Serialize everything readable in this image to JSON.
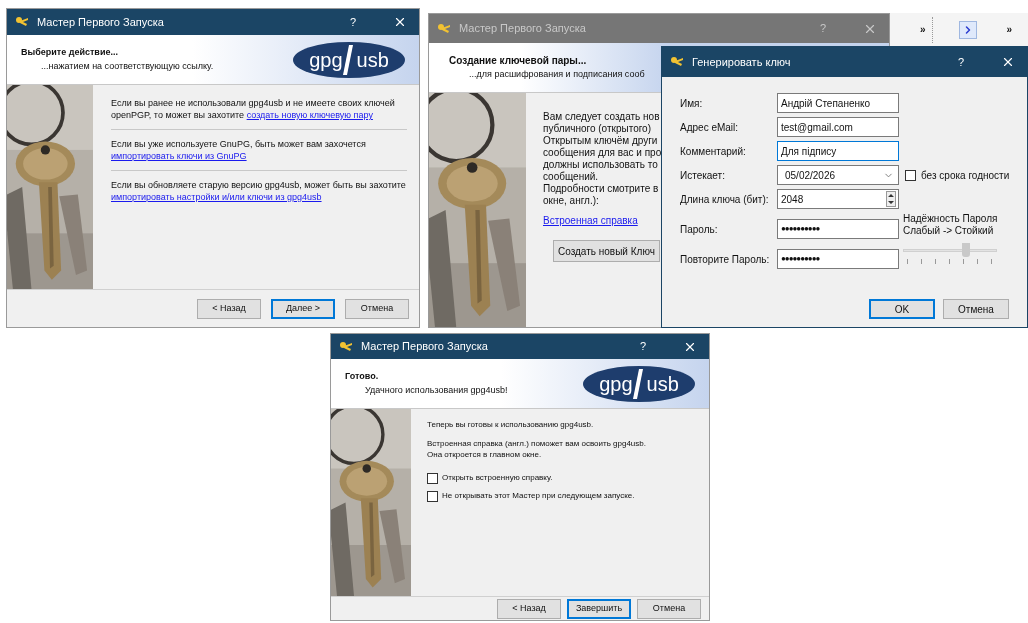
{
  "wizard_start": {
    "title": "Мастер Первого Запуска",
    "active": true,
    "help": "?",
    "header_title": "Выберите действие...",
    "header_subtitle": "...нажатием на соответствующую ссылку.",
    "logo": [
      "gpg",
      "usb"
    ],
    "paragraphs": [
      {
        "text": "Если вы ранее не использовали gpg4usb и не имеете своих ключей openPGP, то может вы захотите",
        "link": "создать новую ключевую пару"
      },
      {
        "text": "Если вы уже используете GnuPG, быть может вам захочется",
        "link": "импортировать ключи из GnuPG"
      },
      {
        "text": "Если вы обновляете старую версию gpg4usb, может быть вы захотите",
        "link": "импортировать настройки и/или ключи из gpg4usb"
      }
    ],
    "buttons": [
      {
        "label": "< Назад",
        "focused": false
      },
      {
        "label": "Далее >",
        "focused": true
      },
      {
        "label": "Отмена",
        "focused": false
      }
    ]
  },
  "wizard_keypair": {
    "title": "Мастер Первого Запуска",
    "active": false,
    "help": "?",
    "header_title": "Создание ключевой пары...",
    "header_subtitle": "...для расшифрования и подписания сооб",
    "lines": [
      "Вам следует создать нов",
      "публичного (открытого)",
      "Открытым ключём други",
      "сообщения для вас и про",
      "должны использовать то",
      "сообщений.",
      "Подробности смотрите в",
      "окне, англ.):"
    ],
    "link": "Встроенная справка",
    "button": "Создать новый Ключ"
  },
  "background_toolbar": {
    "overflow_marks": [
      "»",
      "»"
    ]
  },
  "keygen_dialog": {
    "title": "Генерировать ключ",
    "active": true,
    "help": "?",
    "fields": [
      {
        "label": "Имя:",
        "value": "Андрій Степаненко",
        "kind": "text",
        "focused": false
      },
      {
        "label": "Адрес eMail:",
        "value": "test@gmail.com",
        "kind": "text",
        "focused": false
      },
      {
        "label": "Комментарий:",
        "value": "Для підпису",
        "kind": "text",
        "focused": true
      },
      {
        "label": "Истекает:",
        "value": "05/02/2026",
        "kind": "date",
        "focused": false
      },
      {
        "label": "Длина ключа (бит):",
        "value": "2048",
        "kind": "spin",
        "focused": false
      },
      {
        "label": "Пароль:",
        "value": "●●●●●●●●●●",
        "kind": "password",
        "focused": false
      },
      {
        "label": "Повторите Пароль:",
        "value": "●●●●●●●●●●",
        "kind": "password",
        "focused": false
      }
    ],
    "no_expiry": {
      "label": "без срока годности",
      "checked": false
    },
    "strength": {
      "title": "Надёжность Пароля",
      "range": "Слабый -> Стойкий",
      "level": 0.67
    },
    "buttons": [
      {
        "label": "OK",
        "focused": true
      },
      {
        "label": "Отмена",
        "focused": false
      }
    ]
  },
  "wizard_finish": {
    "title": "Мастер Первого Запуска",
    "active": true,
    "help": "?",
    "header_title": "Готово.",
    "header_subtitle": "Удачного использования gpg4usb!",
    "logo": [
      "gpg",
      "usb"
    ],
    "paragraphs": [
      [
        "Теперь вы готовы к использованию gpg4usb."
      ],
      [
        "Встроенная справка (англ.) поможет вам освоить gpg4usb.",
        "Она откроется в главном окне."
      ]
    ],
    "checkboxes": [
      {
        "label": "Открыть встроенную справку.",
        "checked": false
      },
      {
        "label": "Не открывать этот Мастер при следующем запуске.",
        "checked": false
      }
    ],
    "buttons": [
      {
        "label": "< Назад",
        "focused": false
      },
      {
        "label": "Завершить",
        "focused": true
      },
      {
        "label": "Отмена",
        "focused": false
      }
    ]
  }
}
